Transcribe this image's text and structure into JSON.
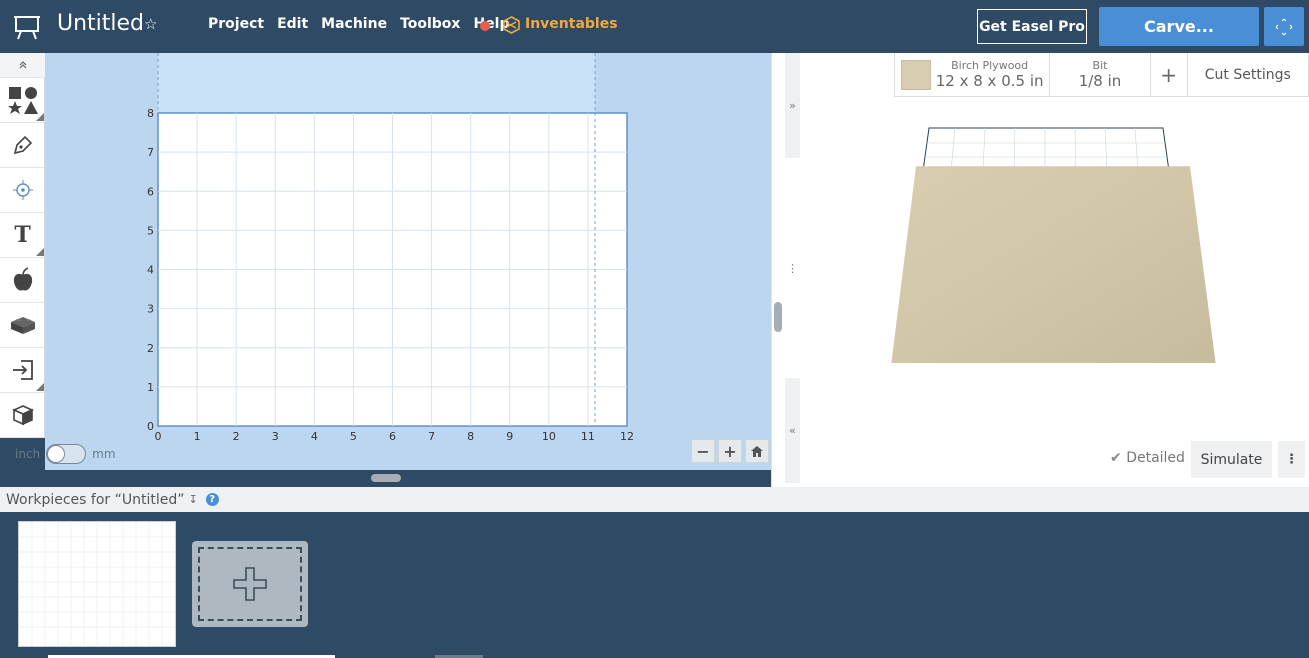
{
  "header": {
    "title": "Untitled",
    "menu": [
      "Project",
      "Edit",
      "Machine",
      "Toolbox",
      "Help"
    ],
    "inventables_label": "Inventables",
    "pro_label": "Get Easel Pro",
    "carve_label": "Carve...",
    "accent_color": "#4a8fd6",
    "brand_color": "#2e4a64",
    "inventables_color": "#f2a93b",
    "status_dot_color": "#e8604c"
  },
  "tools": [
    "collapse-icon",
    "shapes-icon",
    "pen-icon",
    "target-icon",
    "text-icon",
    "apple-icon",
    "apps-icon",
    "import-icon",
    "box-icon"
  ],
  "canvas": {
    "x_ticks": [
      "0",
      "1",
      "2",
      "3",
      "4",
      "5",
      "6",
      "7",
      "8",
      "9",
      "10",
      "11",
      "12"
    ],
    "y_ticks": [
      "0",
      "1",
      "2",
      "3",
      "4",
      "5",
      "6",
      "7",
      "8"
    ],
    "units": {
      "left": "inch",
      "right": "mm"
    },
    "zoom_out": "−",
    "zoom_in": "+"
  },
  "material": {
    "name": "Birch Plywood",
    "dimensions": "12 x 8 x 0.5 in",
    "bit_label": "Bit",
    "bit_value": "1/8 in",
    "plus": "+",
    "cut_settings": "Cut Settings"
  },
  "preview": {
    "detailed_label": "Detailed",
    "simulate_label": "Simulate",
    "more": "⋮"
  },
  "workpieces": {
    "header": "Workpieces for “Untitled”",
    "help": "?"
  }
}
